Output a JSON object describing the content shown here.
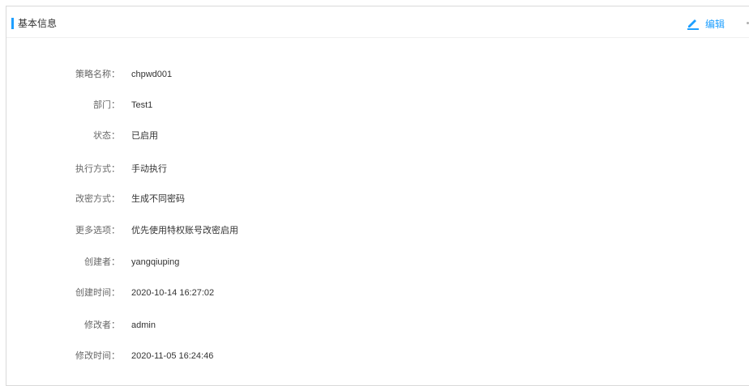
{
  "header": {
    "title": "基本信息",
    "edit_label": "编辑",
    "accent_color": "#1e9fff"
  },
  "fields": [
    {
      "label": "策略名称：",
      "value": "chpwd001"
    },
    {
      "label": "部门：",
      "value": "Test1"
    },
    {
      "label": "状态：",
      "value": "已启用"
    },
    {
      "label": "执行方式：",
      "value": "手动执行"
    },
    {
      "label": "改密方式：",
      "value": "生成不同密码"
    },
    {
      "label": "更多选项：",
      "value": "优先使用特权账号改密启用"
    },
    {
      "label": "创建者：",
      "value": "yangqiuping"
    },
    {
      "label": "创建时间：",
      "value": "2020-10-14 16:27:02"
    },
    {
      "label": "修改者：",
      "value": "admin"
    },
    {
      "label": "修改时间：",
      "value": "2020-11-05 16:24:46"
    }
  ]
}
